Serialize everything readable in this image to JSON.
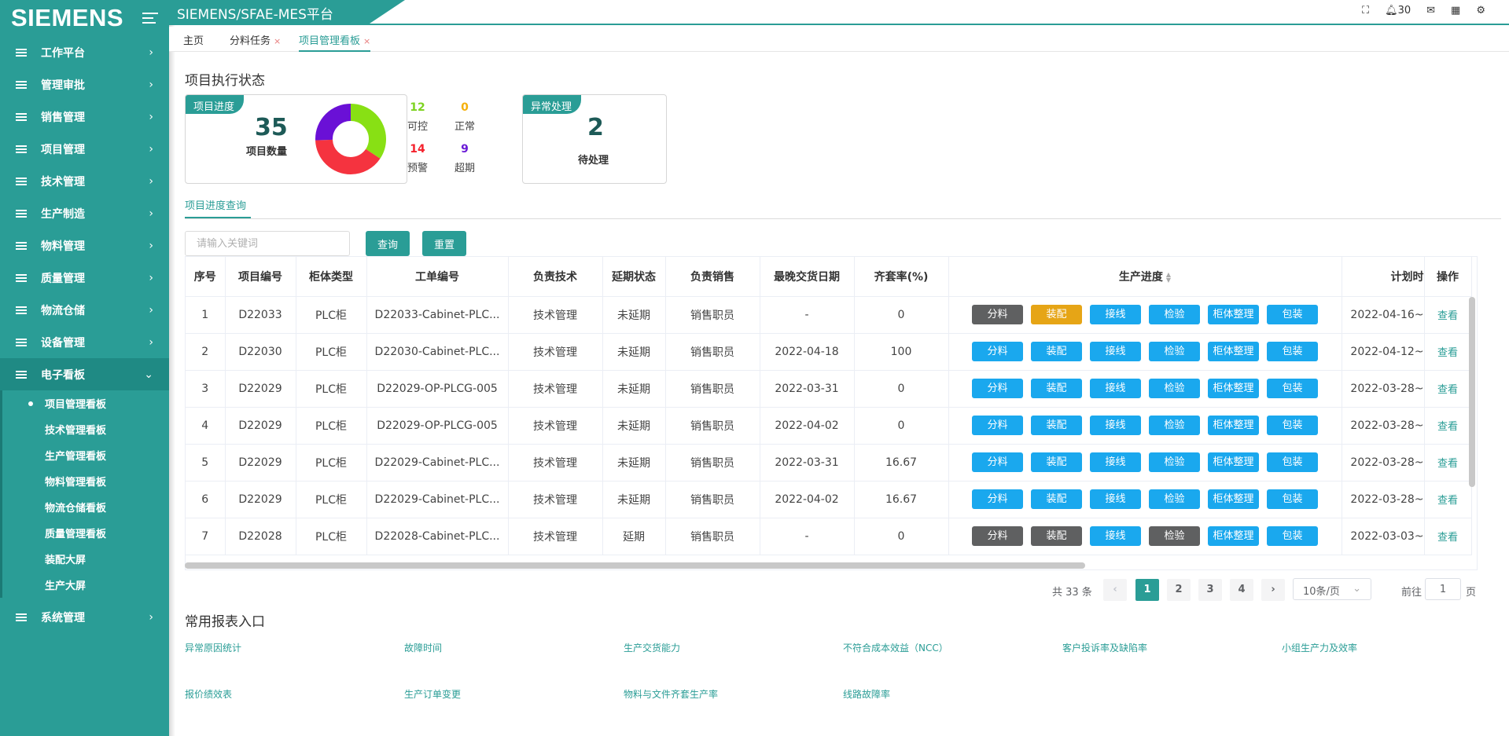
{
  "app": {
    "logo": "SIEMENS",
    "title": "SIEMENS/SFAE-MES平台"
  },
  "header": {
    "notification_count": "30"
  },
  "sidebar": {
    "items": [
      {
        "label": "工作平台"
      },
      {
        "label": "管理审批"
      },
      {
        "label": "销售管理"
      },
      {
        "label": "项目管理"
      },
      {
        "label": "技术管理"
      },
      {
        "label": "生产制造"
      },
      {
        "label": "物料管理"
      },
      {
        "label": "质量管理"
      },
      {
        "label": "物流仓储"
      },
      {
        "label": "设备管理"
      },
      {
        "label": "电子看板"
      }
    ],
    "subitems": [
      {
        "label": "项目管理看板",
        "active": true
      },
      {
        "label": "技术管理看板"
      },
      {
        "label": "生产管理看板"
      },
      {
        "label": "物料管理看板"
      },
      {
        "label": "物流仓储看板"
      },
      {
        "label": "质量管理看板"
      },
      {
        "label": "装配大屏"
      },
      {
        "label": "生产大屏"
      }
    ],
    "last_item": {
      "label": "系统管理"
    }
  },
  "tabs": [
    {
      "label": "主页"
    },
    {
      "label": "分料任务",
      "closable": "×"
    },
    {
      "label": "项目管理看板",
      "closable": "×",
      "active": true
    }
  ],
  "status": {
    "section_title": "项目执行状态",
    "progress_card": {
      "tag": "项目进度",
      "count": "35",
      "count_label": "项目数量",
      "stats": [
        {
          "value": "12",
          "label": "可控",
          "color": "#7ed321"
        },
        {
          "value": "0",
          "label": "正常",
          "color": "#f5b00a"
        },
        {
          "value": "14",
          "label": "预警",
          "color": "#f5222d"
        },
        {
          "value": "9",
          "label": "超期",
          "color": "#6a1bd6"
        }
      ],
      "donut": [
        {
          "label": "可控",
          "value": 12,
          "color": "#88e014"
        },
        {
          "label": "预警",
          "value": 14,
          "color": "#f5333f"
        },
        {
          "label": "超期",
          "value": 9,
          "color": "#6a10d6"
        }
      ]
    },
    "exception_card": {
      "tag": "异常处理",
      "count": "2",
      "count_label": "待处理"
    }
  },
  "query": {
    "tab_label": "项目进度查询",
    "search_placeholder": "请输入关键词",
    "search_button": "查询",
    "reset_button": "重置"
  },
  "table": {
    "headers": [
      "序号",
      "项目编号",
      "柜体类型",
      "工单编号",
      "负责技术",
      "延期状态",
      "负责销售",
      "最晚交货日期",
      "齐套率(%)",
      "生产进度",
      "计划时",
      "操作"
    ],
    "stage_labels": [
      "分料",
      "装配",
      "接线",
      "检验",
      "柜体整理",
      "包装"
    ],
    "view_label": "查看",
    "rows": [
      {
        "no": "1",
        "project": "D22033",
        "cabinet": "PLC柜",
        "order": "D22033-Cabinet-PLC...",
        "tech": "技术管理",
        "delay": "未延期",
        "sales": "销售职员",
        "date": "-",
        "rate": "0",
        "plan": "2022-04-16~",
        "stages": [
          "gray",
          "orange",
          "blue",
          "blue",
          "blue",
          "blue"
        ]
      },
      {
        "no": "2",
        "project": "D22030",
        "cabinet": "PLC柜",
        "order": "D22030-Cabinet-PLC...",
        "tech": "技术管理",
        "delay": "未延期",
        "sales": "销售职员",
        "date": "2022-04-18",
        "rate": "100",
        "plan": "2022-04-12~",
        "stages": [
          "blue",
          "blue",
          "blue",
          "blue",
          "blue",
          "blue"
        ]
      },
      {
        "no": "3",
        "project": "D22029",
        "cabinet": "PLC柜",
        "order": "D22029-OP-PLCG-005",
        "tech": "技术管理",
        "delay": "未延期",
        "sales": "销售职员",
        "date": "2022-03-31",
        "rate": "0",
        "plan": "2022-03-28~",
        "stages": [
          "blue",
          "blue",
          "blue",
          "blue",
          "blue",
          "blue"
        ]
      },
      {
        "no": "4",
        "project": "D22029",
        "cabinet": "PLC柜",
        "order": "D22029-OP-PLCG-005",
        "tech": "技术管理",
        "delay": "未延期",
        "sales": "销售职员",
        "date": "2022-04-02",
        "rate": "0",
        "plan": "2022-03-28~",
        "stages": [
          "blue",
          "blue",
          "blue",
          "blue",
          "blue",
          "blue"
        ]
      },
      {
        "no": "5",
        "project": "D22029",
        "cabinet": "PLC柜",
        "order": "D22029-Cabinet-PLC...",
        "tech": "技术管理",
        "delay": "未延期",
        "sales": "销售职员",
        "date": "2022-03-31",
        "rate": "16.67",
        "plan": "2022-03-28~",
        "stages": [
          "blue",
          "blue",
          "blue",
          "blue",
          "blue",
          "blue"
        ]
      },
      {
        "no": "6",
        "project": "D22029",
        "cabinet": "PLC柜",
        "order": "D22029-Cabinet-PLC...",
        "tech": "技术管理",
        "delay": "未延期",
        "sales": "销售职员",
        "date": "2022-04-02",
        "rate": "16.67",
        "plan": "2022-03-28~",
        "stages": [
          "blue",
          "blue",
          "blue",
          "blue",
          "blue",
          "blue"
        ]
      },
      {
        "no": "7",
        "project": "D22028",
        "cabinet": "PLC柜",
        "order": "D22028-Cabinet-PLC...",
        "tech": "技术管理",
        "delay": "延期",
        "sales": "销售职员",
        "date": "-",
        "rate": "0",
        "plan": "2022-03-03~",
        "stages": [
          "gray",
          "gray",
          "blue",
          "gray",
          "blue",
          "blue"
        ]
      }
    ]
  },
  "pagination": {
    "total": "共 33 条",
    "prev": "‹",
    "next": "›",
    "pages": [
      "1",
      "2",
      "3",
      "4"
    ],
    "current": "1",
    "page_size": "10条/页",
    "goto_label": "前往",
    "goto_value": "1",
    "page_unit": "页"
  },
  "reports": {
    "title": "常用报表入口",
    "links": [
      "异常原因统计",
      "故障时间",
      "生产交货能力",
      "不符合成本效益（NCC）",
      "客户投诉率及缺陷率",
      "小组生产力及效率",
      "报价绩效表",
      "生产订单变更",
      "物料与文件齐套生产率",
      "线路故障率"
    ]
  }
}
